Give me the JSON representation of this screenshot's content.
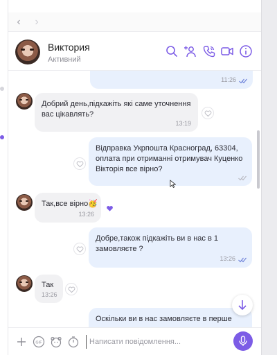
{
  "contact": {
    "name": "Виктория",
    "status": "Активний"
  },
  "header_icons": [
    "search-icon",
    "add-participant-icon",
    "voice-call-icon",
    "video-call-icon",
    "info-icon"
  ],
  "messages": [
    {
      "direction": "out",
      "text": "",
      "time": "11:26",
      "read": true
    },
    {
      "direction": "in",
      "text": "Добрий день,підкажіть які саме уточнення вас цікавлять?",
      "time": "13:19",
      "reaction": "empty"
    },
    {
      "direction": "out",
      "text": "Відправка Укрпошта Красноград, 63304, оплата при отриманні отримувач Куценко Вікторія все вірно?",
      "time": "",
      "read": false,
      "reaction": "empty"
    },
    {
      "direction": "in",
      "text": "Так,все вірно🥳",
      "time": "13:26",
      "reaction": "filled"
    },
    {
      "direction": "out",
      "text": "Добре,також підкажіть ви в нас в 1 замовляєте ?",
      "time": "13:26",
      "read": true,
      "reaction": "empty"
    },
    {
      "direction": "in",
      "text": "Так",
      "time": "13:26",
      "reaction": "empty"
    },
    {
      "direction": "out",
      "text": "Оскільки ви в нас замовляєте в перше",
      "time": "",
      "read": false
    }
  ],
  "composer": {
    "placeholder": "Написати повідомлення...",
    "icons": [
      "plus-icon",
      "gif-icon",
      "sticker-icon",
      "timer-icon",
      "microphone-icon"
    ]
  },
  "colors": {
    "accent": "#7c5ce6",
    "outgoing_bubble": "#e8f0fd",
    "incoming_bubble": "#f1f1f3",
    "read_ticks": "#6a7fd8",
    "reaction_filled": "#7c5ce6"
  }
}
